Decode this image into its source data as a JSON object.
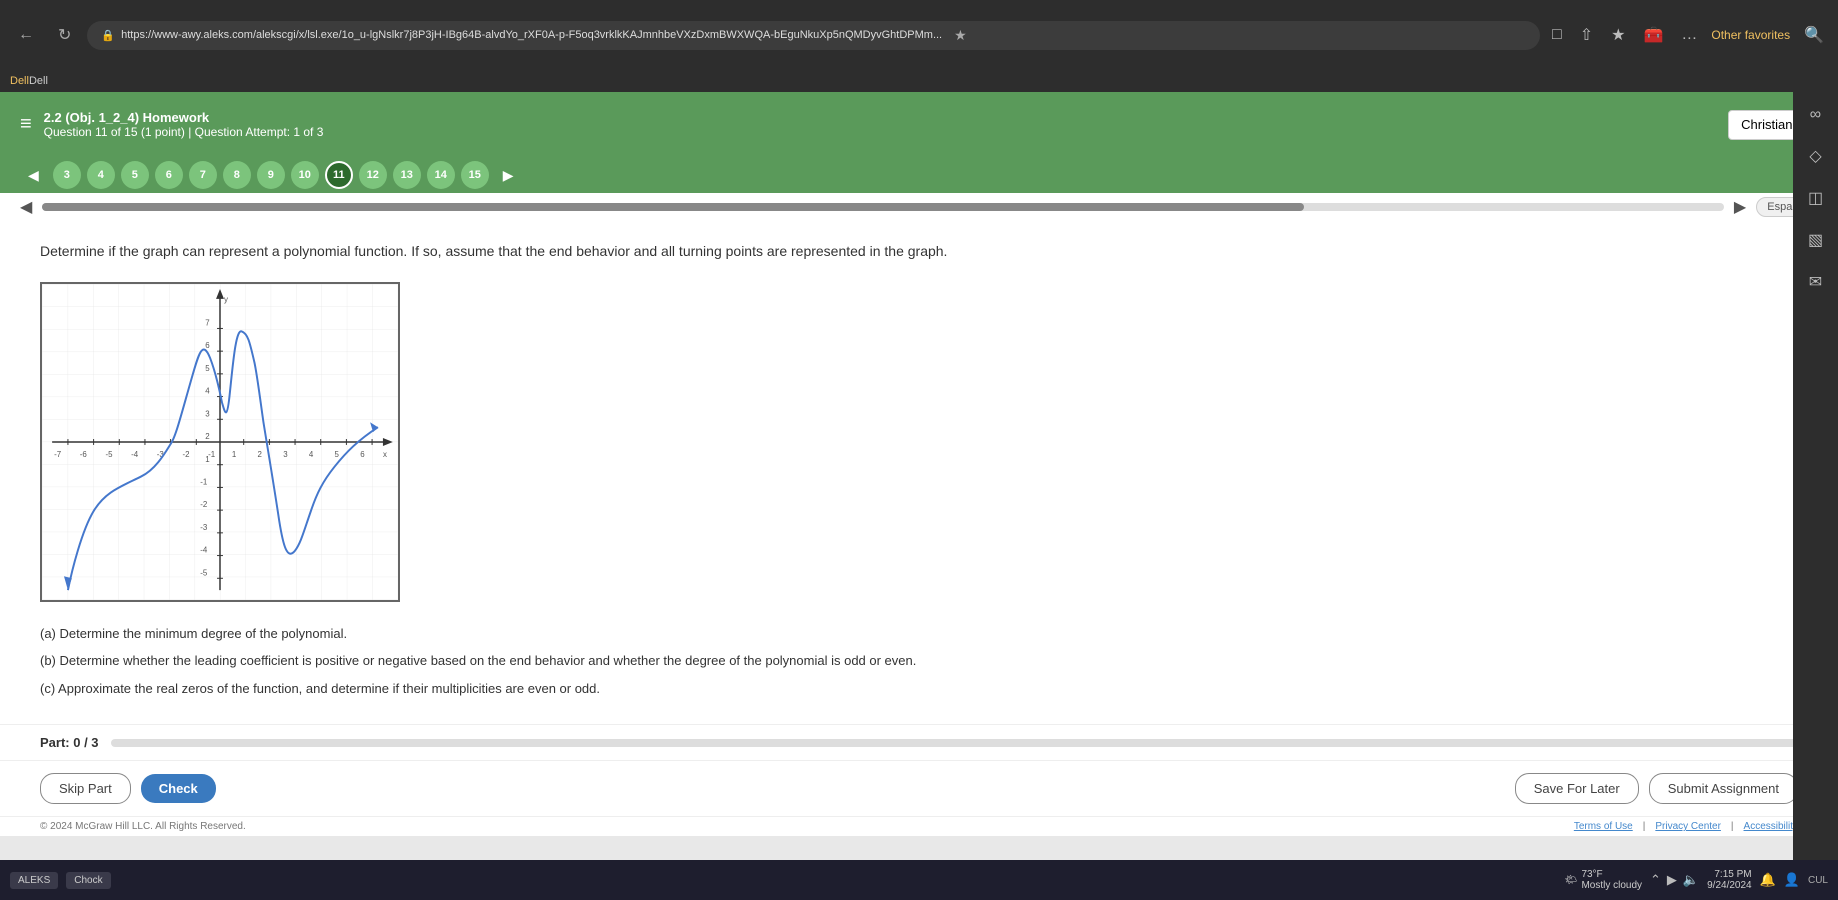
{
  "browser": {
    "url": "https://www-awy.aleks.com/alekscgi/x/lsl.exe/1o_u-lgNslkr7j8P3jH-IBg64B-alvdYo_rXF0A-p-F5oq3vrklkKAJmnhbeVXzDxmBWXWQA-bEguNkuXp5nQMDyvGhtDPMm...",
    "favorites_label": "Other favorites"
  },
  "dell": {
    "label": "Dell"
  },
  "header": {
    "hamburger": "≡",
    "assignment_title": "2.2 (Obj. 1_2_4) Homework",
    "question_info": "Question 11 of 15 (1 point)  |  Question Attempt: 1 of 3",
    "user_name": "Christian",
    "user_dropdown": "▾",
    "espanol": "Español"
  },
  "nav_dots": [
    {
      "label": "3",
      "active": false
    },
    {
      "label": "4",
      "active": false
    },
    {
      "label": "5",
      "active": false
    },
    {
      "label": "6",
      "active": false
    },
    {
      "label": "7",
      "active": false
    },
    {
      "label": "8",
      "active": false
    },
    {
      "label": "9",
      "active": false
    },
    {
      "label": "10",
      "active": false
    },
    {
      "label": "11",
      "active": true
    },
    {
      "label": "12",
      "active": false
    },
    {
      "label": "13",
      "active": false
    },
    {
      "label": "14",
      "active": false
    },
    {
      "label": "15",
      "active": false
    }
  ],
  "question": {
    "text": "Determine if the graph can represent a polynomial function. If so, assume that the end behavior and all turning points are represented in the graph.",
    "sub_a": "(a) Determine the minimum degree of the polynomial.",
    "sub_b": "(b) Determine whether the leading coefficient is positive or negative based on the end behavior and whether the degree of the polynomial is odd or even.",
    "sub_c": "(c) Approximate the real zeros of the function, and determine if their multiplicities are even or odd."
  },
  "part": {
    "label": "Part: 0 / 3"
  },
  "buttons": {
    "skip": "Skip Part",
    "check": "Check",
    "save": "Save For Later",
    "submit": "Submit Assignment"
  },
  "copyright": {
    "text": "© 2024 McGraw Hill LLC. All Rights Reserved.",
    "links": [
      "Terms of Use",
      "Privacy Center",
      "Accessibility"
    ]
  },
  "taskbar": {
    "time": "7:15 PM",
    "date": "9/24/2024",
    "weather_temp": "73°F",
    "weather_desc": "Mostly cloudy"
  },
  "footer_text": {
    "chock": "Chock",
    "cul": "CUL"
  },
  "graph": {
    "x_min": -7,
    "x_max": 7,
    "y_min": -7,
    "y_max": 7
  }
}
